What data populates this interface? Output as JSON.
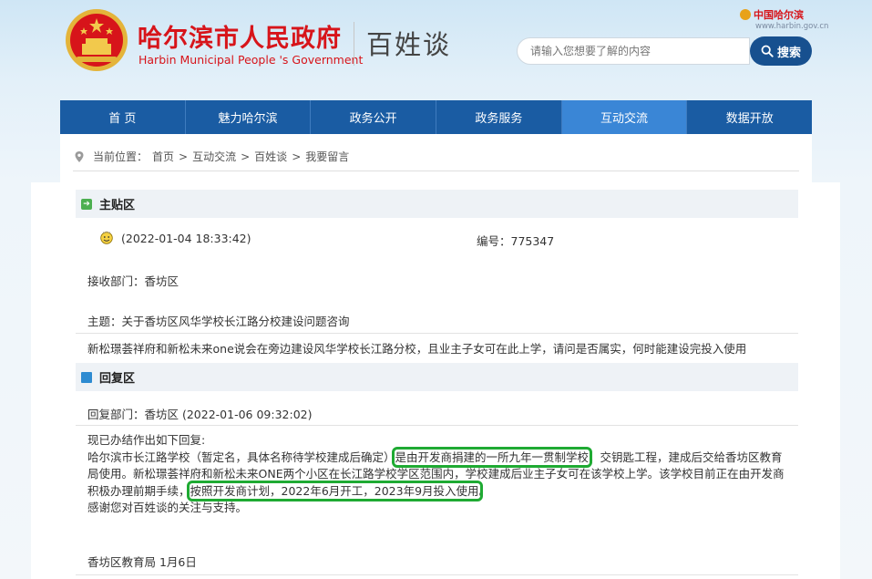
{
  "header": {
    "site_name": "哈尔滨市人民政府",
    "site_name_en": "Harbin Municipal People 's Government",
    "column_name": "百姓谈",
    "china_harbin": "中国哈尔滨",
    "domain": "www.harbin.gov.cn",
    "search": {
      "placeholder": "请输入您想要了解的内容",
      "button_label": "搜索"
    }
  },
  "nav": {
    "items": [
      {
        "label": "首 页"
      },
      {
        "label": "魅力哈尔滨"
      },
      {
        "label": "政务公开"
      },
      {
        "label": "政务服务"
      },
      {
        "label": "互动交流",
        "active": true
      },
      {
        "label": "数据开放"
      }
    ]
  },
  "breadcrumb": {
    "prefix": "当前位置：",
    "items": [
      "首页",
      "互动交流",
      "百姓谈",
      "我要留言"
    ],
    "separator": ">"
  },
  "post": {
    "section_title": "主贴区",
    "time": "(2022-01-04 18:33:42)",
    "number": "编号：775347",
    "department": "接收部门：香坊区",
    "subject": "主题：关于香坊区风华学校长江路分校建设问题咨询",
    "body": "新松璟荟祥府和新松未来one说会在旁边建设风华学校长江路分校，且业主子女可在此上学，请问是否属实，何时能建设完投入使用"
  },
  "reply": {
    "section_title": "回复区",
    "department_time": "回复部门：香坊区 (2022-01-06 09:32:02)",
    "line1": "现已办结作出如下回复:",
    "line2_a": "哈尔滨市长江路学校（暂定名，具体名称待学校建成后确定）",
    "line2_hl": "是由开发商捐建的一所九年一贯制学校",
    "line2_b": "，交钥匙工程，建成后交给香坊区教育局使用。新松璟荟祥府和新松未来ONE两个小区在长江路学校学区范围内，学校建成后业主子女可在该学校上学。该学校目前正在由开发商积极办理前期手续，",
    "line2_hl2": "按照开发商计划，2022年6月开工，2023年9月投入使用",
    "line2_c": "。",
    "line3": "感谢您对百姓谈的关注与支持。",
    "signature": "香坊区教育局 1月6日"
  },
  "colors": {
    "nav_bg": "#1a5ca3",
    "nav_active": "#3a86d6",
    "brand_red": "#d7141a",
    "highlight_green": "#1faa33"
  }
}
